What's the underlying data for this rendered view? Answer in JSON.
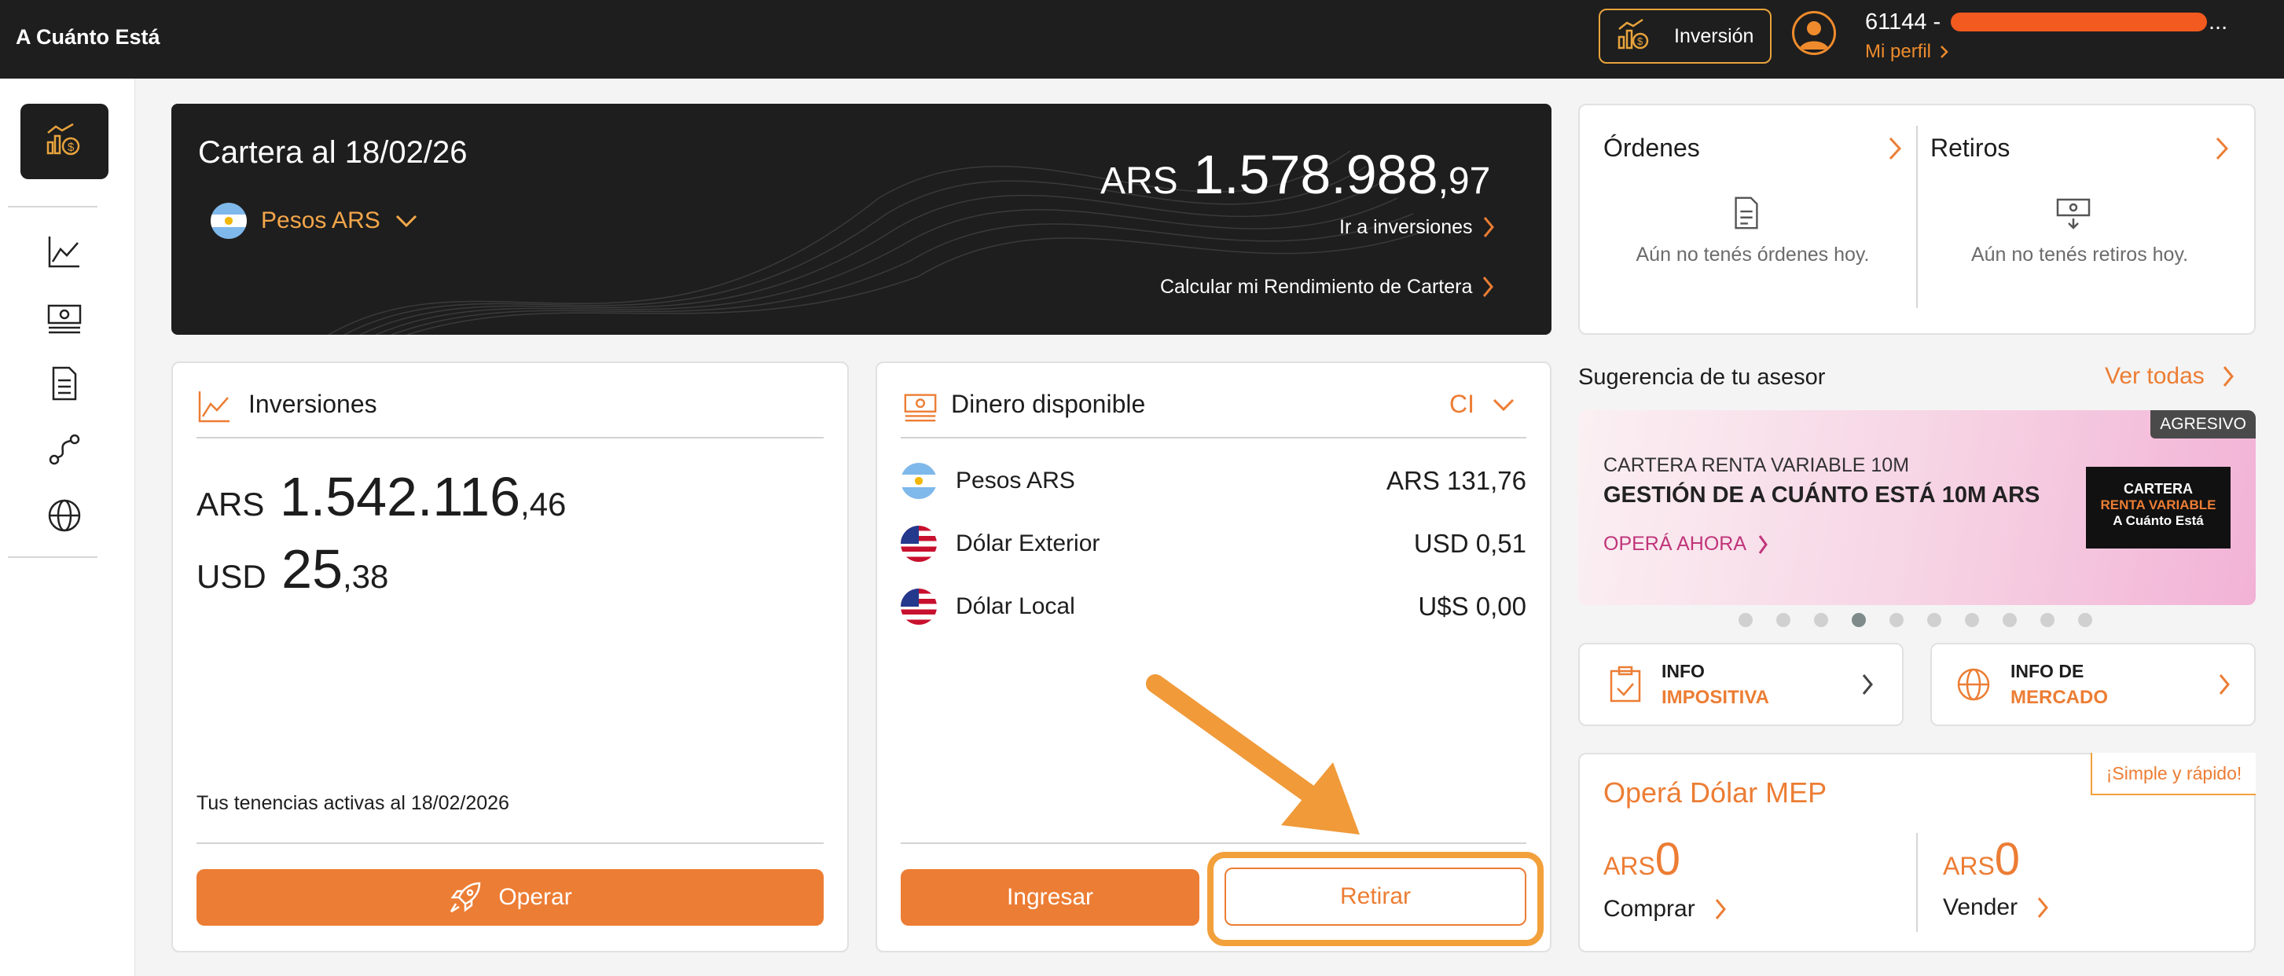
{
  "app": {
    "brand": "A Cuánto Está"
  },
  "topbar": {
    "inversion_label": "Inversión",
    "user_id": "61144 - ",
    "user_name_overflow": "...",
    "profile_label": "Mi perfil"
  },
  "cartera": {
    "title": "Cartera al 18/02/26",
    "currency_selector": "Pesos ARS",
    "amount_currency": "ARS",
    "amount_integer": "1.578.988",
    "amount_decimal": ",97",
    "link_inversiones": "Ir a inversiones",
    "link_rendimiento": "Calcular mi Rendimiento de Cartera"
  },
  "inversiones": {
    "title": "Inversiones",
    "ars_currency": "ARS",
    "ars_integer": "1.542.116",
    "ars_decimal": ",46",
    "usd_currency": "USD",
    "usd_integer": "25",
    "usd_decimal": ",38",
    "footer_text": "Tus tenencias activas al 18/02/2026",
    "operar_label": "Operar"
  },
  "dinero": {
    "title": "Dinero disponible",
    "selector": "CI",
    "rows": [
      {
        "label": "Pesos ARS",
        "value": "ARS 131,76",
        "flag": "ar"
      },
      {
        "label": "Dólar Exterior",
        "value": "USD 0,51",
        "flag": "us"
      },
      {
        "label": "Dólar Local",
        "value": "U$S 0,00",
        "flag": "us"
      }
    ],
    "ingresar_label": "Ingresar",
    "retirar_label": "Retirar"
  },
  "ordenes": {
    "title": "Órdenes",
    "empty": "Aún no tenés órdenes hoy."
  },
  "retiros": {
    "title": "Retiros",
    "empty": "Aún no tenés retiros hoy."
  },
  "sugerencia": {
    "title": "Sugerencia de tu asesor",
    "ver_todas": "Ver todas",
    "badge": "AGRESIVO",
    "subtitle": "CARTERA RENTA VARIABLE 10M",
    "headline": "GESTIÓN DE A CUÁNTO ESTÁ 10M ARS",
    "cta": "OPERÁ AHORA",
    "logo_line1": "CARTERA",
    "logo_line2": "RENTA VARIABLE",
    "logo_line3": "A Cuánto Está",
    "dots_total": 10,
    "dots_active_index": 3
  },
  "info": {
    "impositiva_line1": "INFO",
    "impositiva_line2": "IMPOSITIVA",
    "mercado_line1": "INFO DE",
    "mercado_line2": "MERCADO"
  },
  "mep": {
    "title": "Operá Dólar MEP",
    "badge": "¡Simple y rápido!",
    "buy_currency": "ARS",
    "buy_value": "0",
    "buy_label": "Comprar",
    "sell_currency": "ARS",
    "sell_value": "0",
    "sell_label": "Vender"
  },
  "colors": {
    "accent": "#ec7d34",
    "dark": "#1e1e1e",
    "highlight": "#f2a03b"
  }
}
